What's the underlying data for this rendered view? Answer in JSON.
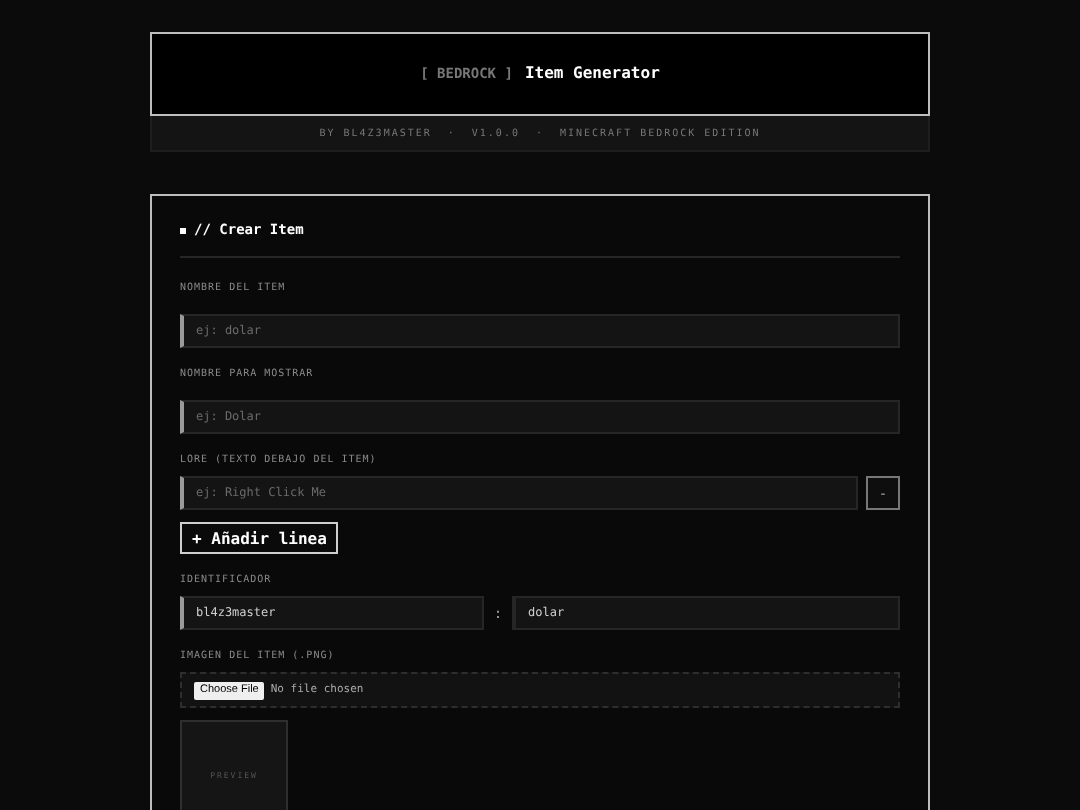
{
  "header": {
    "tag": "[ BEDROCK ]",
    "title": "Item Generator"
  },
  "meta": [
    "BY BL4Z3MASTER",
    "V1.0.0",
    "MINECRAFT BEDROCK EDITION"
  ],
  "meta_separator": "·",
  "card": {
    "title": "// Crear Item",
    "fields": [
      {
        "kind": "text",
        "label": "NOMBRE DEL ITEM",
        "placeholder": "ej: dolar"
      },
      {
        "kind": "text",
        "label": "NOMBRE PARA MOSTRAR",
        "placeholder": "ej: Dolar"
      },
      {
        "kind": "lore",
        "label": "LORE (TEXTO DEBAJO DEL ITEM)",
        "placeholder": "ej: Right Click Me",
        "remove": "-",
        "add": "+ Añadir linea"
      },
      {
        "kind": "identifier",
        "label": "IDENTIFICADOR",
        "namespace": "bl4z3master",
        "separator": ":",
        "name": "dolar"
      },
      {
        "kind": "file",
        "label": "IMAGEN DEL ITEM (.PNG)",
        "button": "Choose File",
        "status": "No file chosen",
        "preview": "PREVIEW"
      }
    ]
  }
}
